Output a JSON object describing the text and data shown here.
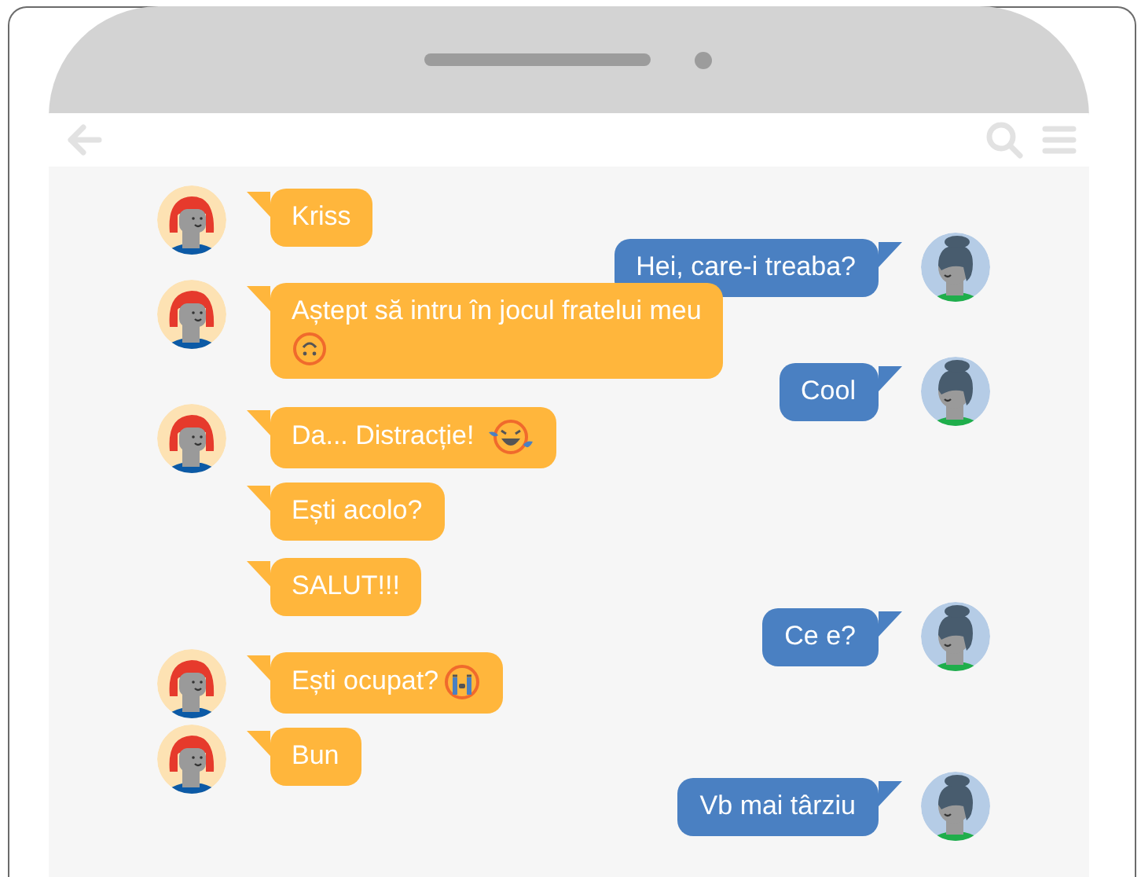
{
  "messages": [
    {
      "kind": "received",
      "avatar": true,
      "content": [
        {
          "kind": "text",
          "text": "Kriss"
        }
      ]
    },
    {
      "kind": "sent",
      "avatar": true,
      "content": [
        {
          "kind": "text",
          "text": "Hei, care-i treaba?"
        }
      ]
    },
    {
      "kind": "received",
      "avatar": true,
      "content": [
        {
          "kind": "text",
          "text": "Aștept să intru în jocul fratelui meu"
        },
        {
          "kind": "upside-down-face"
        }
      ]
    },
    {
      "kind": "sent",
      "avatar": true,
      "content": [
        {
          "kind": "text",
          "text": "Cool"
        }
      ]
    },
    {
      "kind": "received",
      "avatar": true,
      "content": [
        {
          "kind": "text",
          "text": "Da... Distracție!"
        },
        {
          "kind": "laughing-face"
        }
      ]
    },
    {
      "kind": "received",
      "avatar": false,
      "content": [
        {
          "kind": "text",
          "text": "Ești acolo?"
        }
      ]
    },
    {
      "kind": "received",
      "avatar": false,
      "content": [
        {
          "kind": "text",
          "text": "SALUT!!!"
        }
      ]
    },
    {
      "kind": "sent",
      "avatar": true,
      "content": [
        {
          "kind": "text",
          "text": "Ce e?"
        }
      ]
    },
    {
      "kind": "received",
      "avatar": true,
      "content": [
        {
          "kind": "text",
          "text": "Ești ocupat?"
        },
        {
          "kind": "crying-face"
        }
      ]
    },
    {
      "kind": "received",
      "avatar": true,
      "content": [
        {
          "kind": "text",
          "text": "Bun"
        }
      ]
    },
    {
      "kind": "sent",
      "avatar": true,
      "content": [
        {
          "kind": "text",
          "text": "Vb mai târziu"
        }
      ]
    }
  ]
}
